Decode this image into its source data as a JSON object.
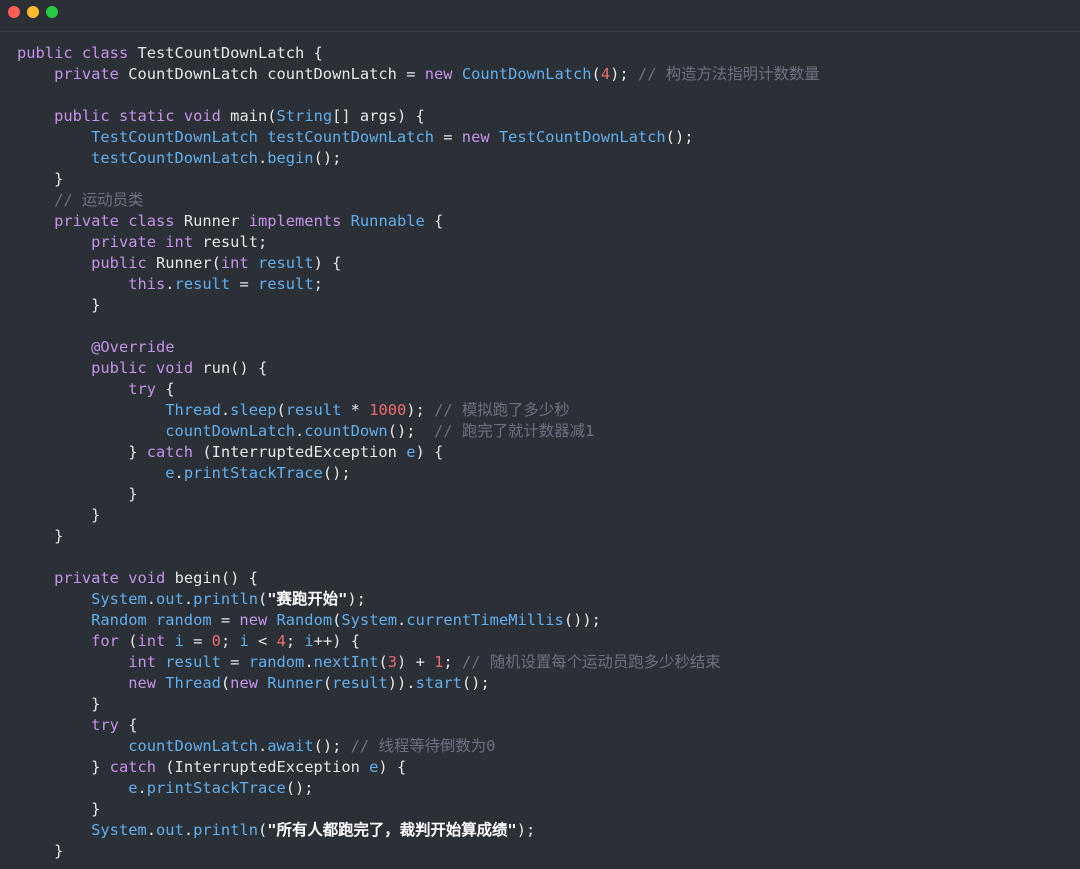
{
  "window": {
    "title_controls": [
      "close",
      "minimize",
      "maximize"
    ]
  },
  "colors": {
    "background": "#2b2f36",
    "keyword": "#c792ea",
    "type": "#61afef",
    "plain": "#e5e7eb",
    "comment": "#6b7380",
    "number": "#ef6b73",
    "string": "#ffffff",
    "close": "#fe5f57",
    "minimize": "#febc2e",
    "maximize": "#28c840"
  },
  "code": {
    "lines": [
      [
        [
          "keyword",
          "public "
        ],
        [
          "keyword",
          "class "
        ],
        [
          "plain",
          "TestCountDownLatch {"
        ]
      ],
      [
        [
          "plain",
          "    "
        ],
        [
          "keyword",
          "private "
        ],
        [
          "plain",
          "CountDownLatch countDownLatch = "
        ],
        [
          "keyword",
          "new "
        ],
        [
          "type",
          "CountDownLatch"
        ],
        [
          "plain",
          "("
        ],
        [
          "number",
          "4"
        ],
        [
          "plain",
          "); "
        ],
        [
          "comment",
          "// 构造方法指明计数数量"
        ]
      ],
      [
        [
          "plain",
          ""
        ]
      ],
      [
        [
          "plain",
          "    "
        ],
        [
          "keyword",
          "public "
        ],
        [
          "keyword",
          "static "
        ],
        [
          "keyword",
          "void "
        ],
        [
          "plain",
          "main("
        ],
        [
          "type",
          "String"
        ],
        [
          "plain",
          "[] args) {"
        ]
      ],
      [
        [
          "plain",
          "        "
        ],
        [
          "type",
          "TestCountDownLatch testCountDownLatch"
        ],
        [
          "plain",
          " = "
        ],
        [
          "keyword",
          "new "
        ],
        [
          "type",
          "TestCountDownLatch"
        ],
        [
          "plain",
          "();"
        ]
      ],
      [
        [
          "plain",
          "        "
        ],
        [
          "type",
          "testCountDownLatch"
        ],
        [
          "plain",
          "."
        ],
        [
          "type",
          "begin"
        ],
        [
          "plain",
          "();"
        ]
      ],
      [
        [
          "plain",
          "    }"
        ]
      ],
      [
        [
          "plain",
          "    "
        ],
        [
          "comment",
          "// 运动员类"
        ]
      ],
      [
        [
          "plain",
          "    "
        ],
        [
          "keyword",
          "private "
        ],
        [
          "keyword",
          "class "
        ],
        [
          "plain",
          "Runner "
        ],
        [
          "keyword",
          "implements "
        ],
        [
          "type",
          "Runnable"
        ],
        [
          "plain",
          " {"
        ]
      ],
      [
        [
          "plain",
          "        "
        ],
        [
          "keyword",
          "private "
        ],
        [
          "keyword",
          "int "
        ],
        [
          "plain",
          "result;"
        ]
      ],
      [
        [
          "plain",
          "        "
        ],
        [
          "keyword",
          "public "
        ],
        [
          "plain",
          "Runner("
        ],
        [
          "keyword",
          "int "
        ],
        [
          "type",
          "result"
        ],
        [
          "plain",
          ") {"
        ]
      ],
      [
        [
          "plain",
          "            "
        ],
        [
          "keyword",
          "this"
        ],
        [
          "plain",
          "."
        ],
        [
          "type",
          "result"
        ],
        [
          "plain",
          " = "
        ],
        [
          "type",
          "result"
        ],
        [
          "plain",
          ";"
        ]
      ],
      [
        [
          "plain",
          "        }"
        ]
      ],
      [
        [
          "plain",
          ""
        ]
      ],
      [
        [
          "plain",
          "        "
        ],
        [
          "keyword",
          "@Override"
        ]
      ],
      [
        [
          "plain",
          "        "
        ],
        [
          "keyword",
          "public "
        ],
        [
          "keyword",
          "void "
        ],
        [
          "plain",
          "run() {"
        ]
      ],
      [
        [
          "plain",
          "            "
        ],
        [
          "keyword",
          "try "
        ],
        [
          "plain",
          "{"
        ]
      ],
      [
        [
          "plain",
          "                "
        ],
        [
          "type",
          "Thread"
        ],
        [
          "plain",
          "."
        ],
        [
          "type",
          "sleep"
        ],
        [
          "plain",
          "("
        ],
        [
          "type",
          "result"
        ],
        [
          "plain",
          " * "
        ],
        [
          "number",
          "1000"
        ],
        [
          "plain",
          "); "
        ],
        [
          "comment",
          "// 模拟跑了多少秒"
        ]
      ],
      [
        [
          "plain",
          "                "
        ],
        [
          "type",
          "countDownLatch"
        ],
        [
          "plain",
          "."
        ],
        [
          "type",
          "countDown"
        ],
        [
          "plain",
          "();  "
        ],
        [
          "comment",
          "// 跑完了就计数器减1"
        ]
      ],
      [
        [
          "plain",
          "            } "
        ],
        [
          "keyword",
          "catch "
        ],
        [
          "plain",
          "(InterruptedException "
        ],
        [
          "type",
          "e"
        ],
        [
          "plain",
          ") {"
        ]
      ],
      [
        [
          "plain",
          "                "
        ],
        [
          "type",
          "e"
        ],
        [
          "plain",
          "."
        ],
        [
          "type",
          "printStackTrace"
        ],
        [
          "plain",
          "();"
        ]
      ],
      [
        [
          "plain",
          "            }"
        ]
      ],
      [
        [
          "plain",
          "        }"
        ]
      ],
      [
        [
          "plain",
          "    }"
        ]
      ],
      [
        [
          "plain",
          ""
        ]
      ],
      [
        [
          "plain",
          "    "
        ],
        [
          "keyword",
          "private "
        ],
        [
          "keyword",
          "void "
        ],
        [
          "plain",
          "begin() {"
        ]
      ],
      [
        [
          "plain",
          "        "
        ],
        [
          "type",
          "System"
        ],
        [
          "plain",
          "."
        ],
        [
          "type",
          "out"
        ],
        [
          "plain",
          "."
        ],
        [
          "type",
          "println"
        ],
        [
          "plain",
          "("
        ],
        [
          "string",
          "\"赛跑开始\""
        ],
        [
          "plain",
          ");"
        ]
      ],
      [
        [
          "plain",
          "        "
        ],
        [
          "type",
          "Random random"
        ],
        [
          "plain",
          " = "
        ],
        [
          "keyword",
          "new "
        ],
        [
          "type",
          "Random"
        ],
        [
          "plain",
          "("
        ],
        [
          "type",
          "System"
        ],
        [
          "plain",
          "."
        ],
        [
          "type",
          "currentTimeMillis"
        ],
        [
          "plain",
          "());"
        ]
      ],
      [
        [
          "plain",
          "        "
        ],
        [
          "keyword",
          "for "
        ],
        [
          "plain",
          "("
        ],
        [
          "keyword",
          "int "
        ],
        [
          "type",
          "i"
        ],
        [
          "plain",
          " = "
        ],
        [
          "number",
          "0"
        ],
        [
          "plain",
          "; "
        ],
        [
          "type",
          "i"
        ],
        [
          "plain",
          " < "
        ],
        [
          "number",
          "4"
        ],
        [
          "plain",
          "; "
        ],
        [
          "type",
          "i"
        ],
        [
          "plain",
          "++) {"
        ]
      ],
      [
        [
          "plain",
          "            "
        ],
        [
          "keyword",
          "int "
        ],
        [
          "type",
          "result"
        ],
        [
          "plain",
          " = "
        ],
        [
          "type",
          "random"
        ],
        [
          "plain",
          "."
        ],
        [
          "type",
          "nextInt"
        ],
        [
          "plain",
          "("
        ],
        [
          "number",
          "3"
        ],
        [
          "plain",
          ") + "
        ],
        [
          "number",
          "1"
        ],
        [
          "plain",
          "; "
        ],
        [
          "comment",
          "// 随机设置每个运动员跑多少秒结束"
        ]
      ],
      [
        [
          "plain",
          "            "
        ],
        [
          "keyword",
          "new "
        ],
        [
          "type",
          "Thread"
        ],
        [
          "plain",
          "("
        ],
        [
          "keyword",
          "new "
        ],
        [
          "type",
          "Runner"
        ],
        [
          "plain",
          "("
        ],
        [
          "type",
          "result"
        ],
        [
          "plain",
          "))."
        ],
        [
          "type",
          "start"
        ],
        [
          "plain",
          "();"
        ]
      ],
      [
        [
          "plain",
          "        }"
        ]
      ],
      [
        [
          "plain",
          "        "
        ],
        [
          "keyword",
          "try "
        ],
        [
          "plain",
          "{"
        ]
      ],
      [
        [
          "plain",
          "            "
        ],
        [
          "type",
          "countDownLatch"
        ],
        [
          "plain",
          "."
        ],
        [
          "type",
          "await"
        ],
        [
          "plain",
          "(); "
        ],
        [
          "comment",
          "// 线程等待倒数为0"
        ]
      ],
      [
        [
          "plain",
          "        } "
        ],
        [
          "keyword",
          "catch "
        ],
        [
          "plain",
          "(InterruptedException "
        ],
        [
          "type",
          "e"
        ],
        [
          "plain",
          ") {"
        ]
      ],
      [
        [
          "plain",
          "            "
        ],
        [
          "type",
          "e"
        ],
        [
          "plain",
          "."
        ],
        [
          "type",
          "printStackTrace"
        ],
        [
          "plain",
          "();"
        ]
      ],
      [
        [
          "plain",
          "        }"
        ]
      ],
      [
        [
          "plain",
          "        "
        ],
        [
          "type",
          "System"
        ],
        [
          "plain",
          "."
        ],
        [
          "type",
          "out"
        ],
        [
          "plain",
          "."
        ],
        [
          "type",
          "println"
        ],
        [
          "plain",
          "("
        ],
        [
          "string",
          "\"所有人都跑完了，裁判开始算成绩\""
        ],
        [
          "plain",
          ");"
        ]
      ],
      [
        [
          "plain",
          "    }"
        ]
      ]
    ]
  }
}
